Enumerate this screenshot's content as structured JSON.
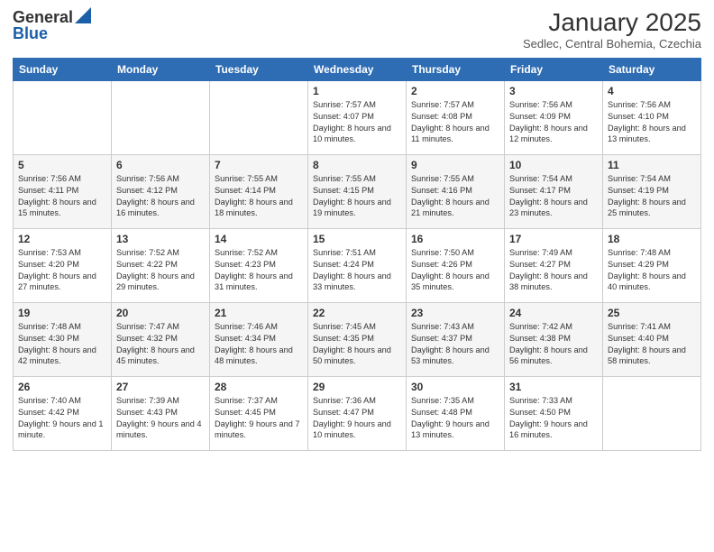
{
  "logo": {
    "general": "General",
    "blue": "Blue"
  },
  "title": "January 2025",
  "location": "Sedlec, Central Bohemia, Czechia",
  "days_of_week": [
    "Sunday",
    "Monday",
    "Tuesday",
    "Wednesday",
    "Thursday",
    "Friday",
    "Saturday"
  ],
  "weeks": [
    [
      {
        "day": "",
        "info": ""
      },
      {
        "day": "",
        "info": ""
      },
      {
        "day": "",
        "info": ""
      },
      {
        "day": "1",
        "info": "Sunrise: 7:57 AM\nSunset: 4:07 PM\nDaylight: 8 hours\nand 10 minutes."
      },
      {
        "day": "2",
        "info": "Sunrise: 7:57 AM\nSunset: 4:08 PM\nDaylight: 8 hours\nand 11 minutes."
      },
      {
        "day": "3",
        "info": "Sunrise: 7:56 AM\nSunset: 4:09 PM\nDaylight: 8 hours\nand 12 minutes."
      },
      {
        "day": "4",
        "info": "Sunrise: 7:56 AM\nSunset: 4:10 PM\nDaylight: 8 hours\nand 13 minutes."
      }
    ],
    [
      {
        "day": "5",
        "info": "Sunrise: 7:56 AM\nSunset: 4:11 PM\nDaylight: 8 hours\nand 15 minutes."
      },
      {
        "day": "6",
        "info": "Sunrise: 7:56 AM\nSunset: 4:12 PM\nDaylight: 8 hours\nand 16 minutes."
      },
      {
        "day": "7",
        "info": "Sunrise: 7:55 AM\nSunset: 4:14 PM\nDaylight: 8 hours\nand 18 minutes."
      },
      {
        "day": "8",
        "info": "Sunrise: 7:55 AM\nSunset: 4:15 PM\nDaylight: 8 hours\nand 19 minutes."
      },
      {
        "day": "9",
        "info": "Sunrise: 7:55 AM\nSunset: 4:16 PM\nDaylight: 8 hours\nand 21 minutes."
      },
      {
        "day": "10",
        "info": "Sunrise: 7:54 AM\nSunset: 4:17 PM\nDaylight: 8 hours\nand 23 minutes."
      },
      {
        "day": "11",
        "info": "Sunrise: 7:54 AM\nSunset: 4:19 PM\nDaylight: 8 hours\nand 25 minutes."
      }
    ],
    [
      {
        "day": "12",
        "info": "Sunrise: 7:53 AM\nSunset: 4:20 PM\nDaylight: 8 hours\nand 27 minutes."
      },
      {
        "day": "13",
        "info": "Sunrise: 7:52 AM\nSunset: 4:22 PM\nDaylight: 8 hours\nand 29 minutes."
      },
      {
        "day": "14",
        "info": "Sunrise: 7:52 AM\nSunset: 4:23 PM\nDaylight: 8 hours\nand 31 minutes."
      },
      {
        "day": "15",
        "info": "Sunrise: 7:51 AM\nSunset: 4:24 PM\nDaylight: 8 hours\nand 33 minutes."
      },
      {
        "day": "16",
        "info": "Sunrise: 7:50 AM\nSunset: 4:26 PM\nDaylight: 8 hours\nand 35 minutes."
      },
      {
        "day": "17",
        "info": "Sunrise: 7:49 AM\nSunset: 4:27 PM\nDaylight: 8 hours\nand 38 minutes."
      },
      {
        "day": "18",
        "info": "Sunrise: 7:48 AM\nSunset: 4:29 PM\nDaylight: 8 hours\nand 40 minutes."
      }
    ],
    [
      {
        "day": "19",
        "info": "Sunrise: 7:48 AM\nSunset: 4:30 PM\nDaylight: 8 hours\nand 42 minutes."
      },
      {
        "day": "20",
        "info": "Sunrise: 7:47 AM\nSunset: 4:32 PM\nDaylight: 8 hours\nand 45 minutes."
      },
      {
        "day": "21",
        "info": "Sunrise: 7:46 AM\nSunset: 4:34 PM\nDaylight: 8 hours\nand 48 minutes."
      },
      {
        "day": "22",
        "info": "Sunrise: 7:45 AM\nSunset: 4:35 PM\nDaylight: 8 hours\nand 50 minutes."
      },
      {
        "day": "23",
        "info": "Sunrise: 7:43 AM\nSunset: 4:37 PM\nDaylight: 8 hours\nand 53 minutes."
      },
      {
        "day": "24",
        "info": "Sunrise: 7:42 AM\nSunset: 4:38 PM\nDaylight: 8 hours\nand 56 minutes."
      },
      {
        "day": "25",
        "info": "Sunrise: 7:41 AM\nSunset: 4:40 PM\nDaylight: 8 hours\nand 58 minutes."
      }
    ],
    [
      {
        "day": "26",
        "info": "Sunrise: 7:40 AM\nSunset: 4:42 PM\nDaylight: 9 hours\nand 1 minute."
      },
      {
        "day": "27",
        "info": "Sunrise: 7:39 AM\nSunset: 4:43 PM\nDaylight: 9 hours\nand 4 minutes."
      },
      {
        "day": "28",
        "info": "Sunrise: 7:37 AM\nSunset: 4:45 PM\nDaylight: 9 hours\nand 7 minutes."
      },
      {
        "day": "29",
        "info": "Sunrise: 7:36 AM\nSunset: 4:47 PM\nDaylight: 9 hours\nand 10 minutes."
      },
      {
        "day": "30",
        "info": "Sunrise: 7:35 AM\nSunset: 4:48 PM\nDaylight: 9 hours\nand 13 minutes."
      },
      {
        "day": "31",
        "info": "Sunrise: 7:33 AM\nSunset: 4:50 PM\nDaylight: 9 hours\nand 16 minutes."
      },
      {
        "day": "",
        "info": ""
      }
    ]
  ]
}
